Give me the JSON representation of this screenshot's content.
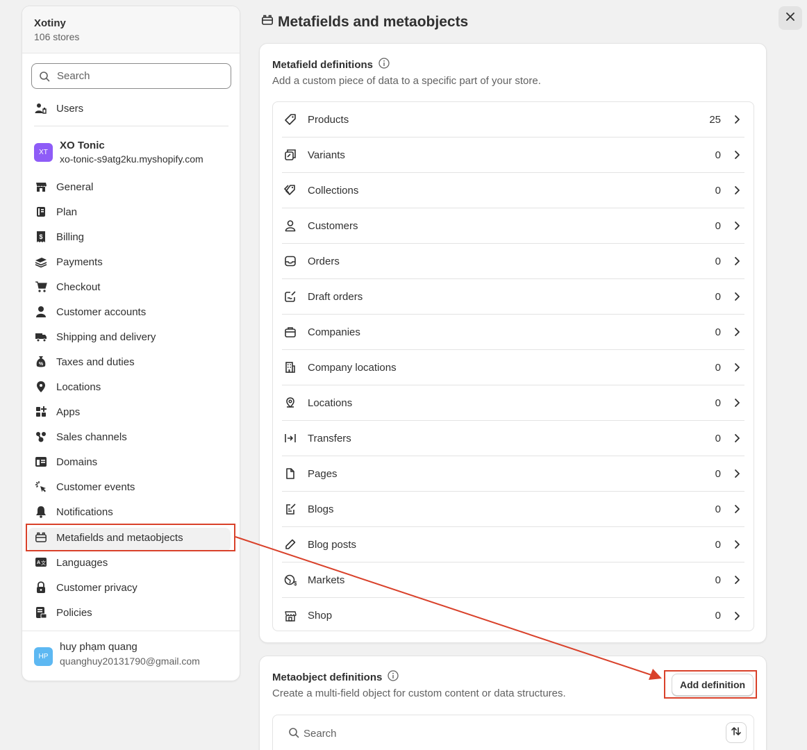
{
  "sidebar": {
    "org_name": "Xotiny",
    "org_sub": "106 stores",
    "search_placeholder": "Search",
    "users_label": "Users",
    "store": {
      "initials": "XT",
      "name": "XO Tonic",
      "url": "xo-tonic-s9atg2ku.myshopify.com",
      "avatar_color": "#8e5cf7"
    },
    "items": [
      {
        "label": "General",
        "icon": "store-icon"
      },
      {
        "label": "Plan",
        "icon": "plan-icon"
      },
      {
        "label": "Billing",
        "icon": "billing-icon"
      },
      {
        "label": "Payments",
        "icon": "payments-icon"
      },
      {
        "label": "Checkout",
        "icon": "cart-icon"
      },
      {
        "label": "Customer accounts",
        "icon": "person-icon"
      },
      {
        "label": "Shipping and delivery",
        "icon": "truck-icon"
      },
      {
        "label": "Taxes and duties",
        "icon": "tax-icon"
      },
      {
        "label": "Locations",
        "icon": "location-icon"
      },
      {
        "label": "Apps",
        "icon": "apps-icon"
      },
      {
        "label": "Sales channels",
        "icon": "channels-icon"
      },
      {
        "label": "Domains",
        "icon": "domains-icon"
      },
      {
        "label": "Customer events",
        "icon": "events-icon"
      },
      {
        "label": "Notifications",
        "icon": "bell-icon"
      },
      {
        "label": "Metafields and metaobjects",
        "icon": "metafields-icon"
      },
      {
        "label": "Languages",
        "icon": "languages-icon"
      },
      {
        "label": "Customer privacy",
        "icon": "lock-icon"
      },
      {
        "label": "Policies",
        "icon": "policies-icon"
      }
    ],
    "active_item": "Metafields and metaobjects",
    "user": {
      "initials": "HP",
      "name": "huy phạm quang",
      "email": "quanghuy20131790@gmail.com",
      "avatar_color": "#5db8f2"
    }
  },
  "page": {
    "title": "Metafields and metaobjects"
  },
  "metafields": {
    "heading": "Metafield definitions",
    "description": "Add a custom piece of data to a specific part of your store.",
    "rows": [
      {
        "label": "Products",
        "count": "25",
        "icon": "tag-icon"
      },
      {
        "label": "Variants",
        "count": "0",
        "icon": "variants-icon"
      },
      {
        "label": "Collections",
        "count": "0",
        "icon": "collections-icon"
      },
      {
        "label": "Customers",
        "count": "0",
        "icon": "person-icon"
      },
      {
        "label": "Orders",
        "count": "0",
        "icon": "inbox-icon"
      },
      {
        "label": "Draft orders",
        "count": "0",
        "icon": "draft-icon"
      },
      {
        "label": "Companies",
        "count": "0",
        "icon": "briefcase-icon"
      },
      {
        "label": "Company locations",
        "count": "0",
        "icon": "building-icon"
      },
      {
        "label": "Locations",
        "count": "0",
        "icon": "location-icon"
      },
      {
        "label": "Transfers",
        "count": "0",
        "icon": "transfer-icon"
      },
      {
        "label": "Pages",
        "count": "0",
        "icon": "page-icon"
      },
      {
        "label": "Blogs",
        "count": "0",
        "icon": "blog-icon"
      },
      {
        "label": "Blog posts",
        "count": "0",
        "icon": "pencil-icon"
      },
      {
        "label": "Markets",
        "count": "0",
        "icon": "globe-icon"
      },
      {
        "label": "Shop",
        "count": "0",
        "icon": "shop-icon"
      }
    ]
  },
  "metaobjects": {
    "heading": "Metaobject definitions",
    "description": "Create a multi-field object for custom content or data structures.",
    "add_button": "Add definition",
    "search_placeholder": "Search"
  },
  "annotation_color": "#d9412a"
}
